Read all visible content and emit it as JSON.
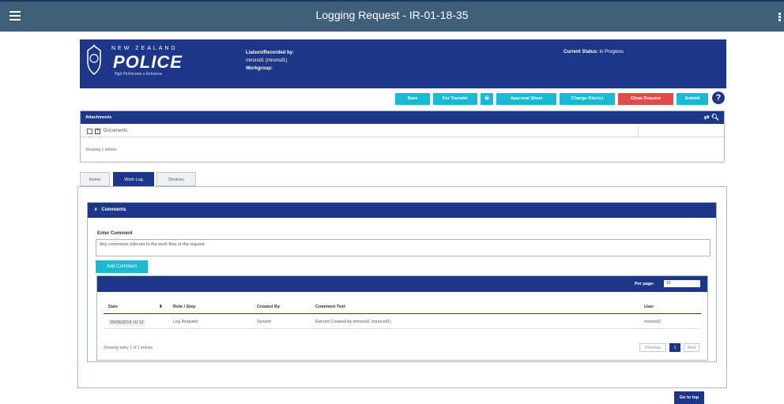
{
  "app": {
    "title": "Logging Request - IR-01-18-35"
  },
  "header": {
    "logo_top": "NEW ZEALAND",
    "logo_main": "POLICE",
    "logo_sub": "Ngā Pirihimana o Aotearoa",
    "liaison_label": "Liaison/Recorded by:",
    "liaison_value": "mnorsd1 (mnorsd1)",
    "workgroup_label": "Workgroup:",
    "status_label": "Current Status:",
    "status_value": "In Progress"
  },
  "actions": {
    "save": "Save",
    "for_transfer": "For Transfer",
    "approval_sheet": "Approval Sheet",
    "change_district": "Change District",
    "close_request": "Close Request",
    "submit": "Submit",
    "help": "?"
  },
  "attachments": {
    "title": "Attachments",
    "row_label": "Documents",
    "showing": "Showing 1 entries"
  },
  "tabs": [
    "Home",
    "Work Log",
    "Devices"
  ],
  "comments": {
    "title": "Comments",
    "enter_label": "Enter Comment",
    "placeholder": "Any comments relevant to the work flow or the request",
    "add_button": "Add Comment",
    "per_page_label": "Per page:",
    "per_page_value": "10",
    "columns": [
      "Date",
      "Role / Step",
      "Created By",
      "Comment Text",
      "User"
    ],
    "rows": [
      {
        "date": "29/06/2018 10:12",
        "role": "Log Request",
        "created_by": "System",
        "comment": "Record Created by mnorsd1 (mnorsd1)",
        "user": "mnorsd1"
      }
    ],
    "footer": "Showing entry 1 of 1 entries",
    "pager": {
      "previous": "Previous",
      "current": "1",
      "next": "Next"
    }
  },
  "go_to_top": "Go to top",
  "colors": {
    "nav": "#1e3687",
    "topbar": "#3f5f78",
    "teal": "#1ab9d4",
    "red": "#e54a4a"
  }
}
